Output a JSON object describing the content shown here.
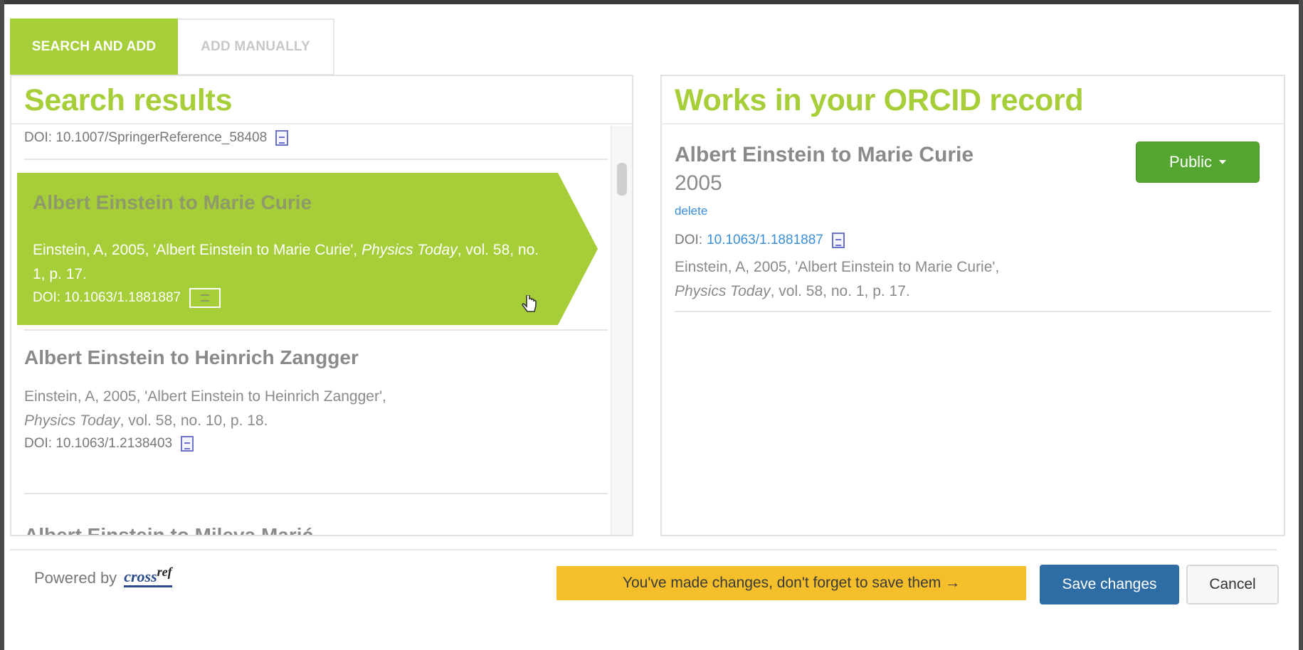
{
  "tabs": [
    {
      "label": "SEARCH AND ADD",
      "active": true
    },
    {
      "label": "ADD MANUALLY",
      "active": false
    }
  ],
  "search_results": {
    "title": "Search results",
    "top_doi": "DOI: 10.1007/SpringerReference_58408",
    "items": [
      {
        "title": "Albert Einstein to Marie Curie",
        "citation_prefix": "Einstein, A, 2005, 'Albert Einstein to Marie Curie', ",
        "journal": "Physics Today",
        "citation_suffix": ", vol. 58, no. 1, p. 17.",
        "doi": "DOI: 10.1063/1.1881887",
        "selected": true
      },
      {
        "title": "Albert Einstein to Heinrich Zangger",
        "citation_prefix": "Einstein, A, 2005, 'Albert Einstein to Heinrich Zangger',",
        "journal": "Physics Today",
        "citation_suffix": ", vol. 58, no. 10, p. 18.",
        "doi": "DOI: 10.1063/1.2138403",
        "selected": false
      },
      {
        "title": "Albert Einstein to Mileva Marić",
        "selected": false
      }
    ]
  },
  "orcid_record": {
    "title": "Works in your ORCID record",
    "work": {
      "title": "Albert Einstein to Marie Curie",
      "year": "2005",
      "delete_label": "delete",
      "doi_label": "DOI:",
      "doi_value": "10.1063/1.1881887",
      "citation_prefix": "Einstein, A, 2005, 'Albert Einstein to Marie Curie',",
      "journal": "Physics Today",
      "citation_suffix": ", vol. 58, no. 1, p. 17.",
      "visibility": "Public"
    }
  },
  "footer": {
    "powered_by": "Powered by",
    "crossref_top": "ref",
    "crossref_bottom": "cross",
    "notice": "You've made changes, don't forget to save them →",
    "save_label": "Save changes",
    "cancel_label": "Cancel"
  },
  "colors": {
    "accent": "#a6ce39",
    "public_button": "#55a630",
    "save_button": "#2e6da4",
    "notice_bg": "#f4bf2a"
  }
}
